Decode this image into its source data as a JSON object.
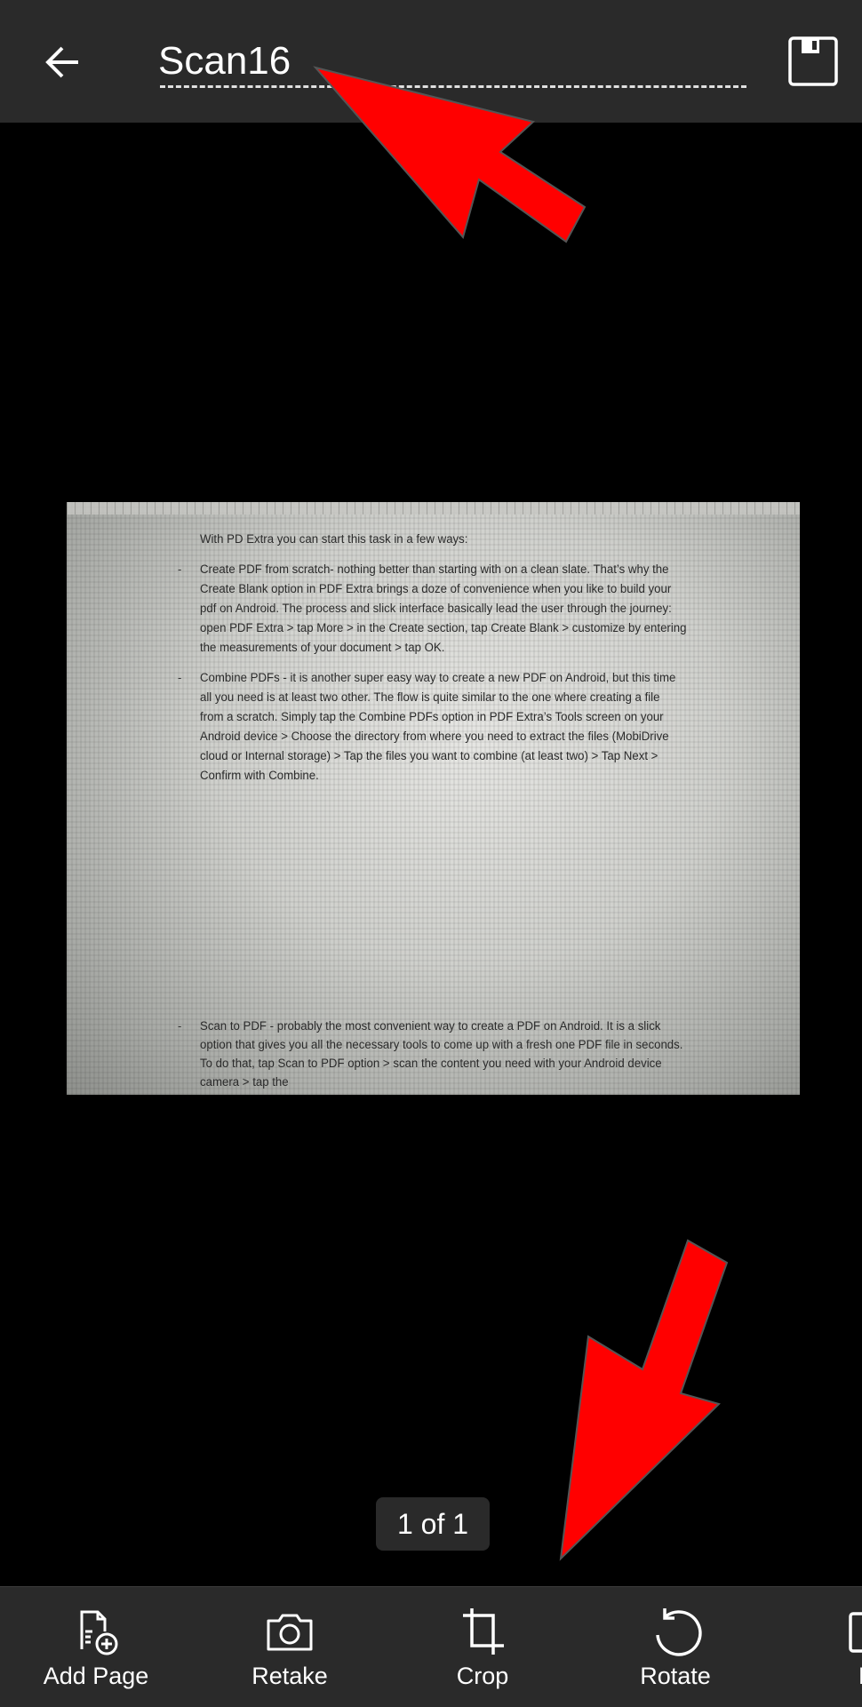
{
  "header": {
    "title": "Scan16",
    "back_icon": "arrow-left-icon",
    "save_icon": "floppy-disk-icon"
  },
  "document": {
    "intro": "With PD Extra you can start this task in a few ways:",
    "bullet_char": "-",
    "paragraphs": [
      [
        "Create PDF from scratch- nothing better than starting with on a clean slate. That’s why the",
        "Create Blank option in PDF Extra brings a doze of convenience when you like to build your",
        "pdf on Android. The process and slick interface basically lead the user through the journey:",
        "open PDF Extra > tap More > in the Create section, tap Create Blank > customize by entering",
        "the measurements of your document > tap OK."
      ],
      [
        "Combine PDFs - it is another super easy way to create a new PDF on Android, but this time",
        "all you need is at least two other. The flow is quite similar to the one where creating a file",
        "from a scratch. Simply tap the Combine PDFs option in PDF Extra’s Tools screen on your",
        "Android device >  Choose the directory from where you need to extract the files (MobiDrive",
        "cloud or Internal storage) > Tap the files you want to combine (at least two) > Tap Next >",
        "Confirm with Combine."
      ],
      [
        "Scan to PDF - probably the most convenient way to create a PDF on Android. It is a slick",
        "option that gives you all the necessary tools to come up with a fresh one PDF file in seconds.",
        "To do that, tap Scan to PDF option > scan the content you need with your Android device",
        "camera > tap the"
      ]
    ]
  },
  "pager": {
    "label": "1 of 1"
  },
  "toolbar": {
    "items": [
      {
        "label": "Add Page",
        "icon": "add-page-icon"
      },
      {
        "label": "Retake",
        "icon": "camera-icon"
      },
      {
        "label": "Crop",
        "icon": "crop-icon"
      },
      {
        "label": "Rotate",
        "icon": "rotate-icon"
      },
      {
        "label": "Fi",
        "icon": "filter-icon"
      }
    ]
  },
  "annotation_color": "#ff0000"
}
